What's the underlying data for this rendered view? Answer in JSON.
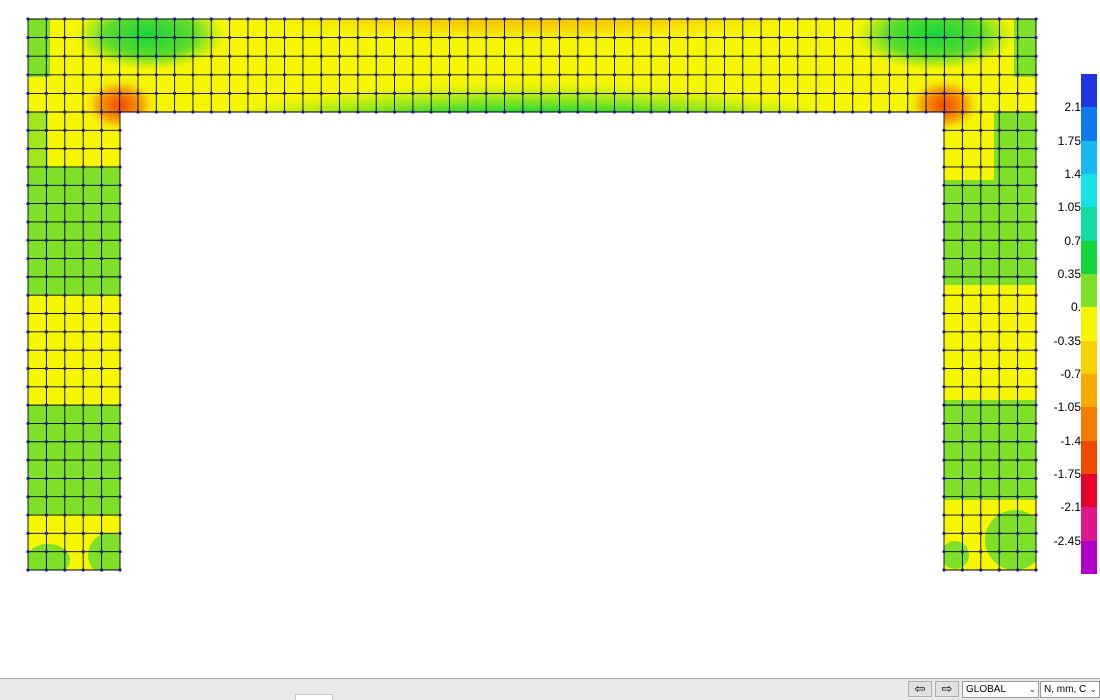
{
  "legend": {
    "labels": [
      "2.1",
      "1.75",
      "1.4",
      "1.05",
      "0.7",
      "0.35",
      "0.",
      "-0.35",
      "-0.7",
      "-1.05",
      "-1.4",
      "-1.75",
      "-2.1",
      "-2.45"
    ],
    "band_colors": [
      "#1f35e0",
      "#0f7af0",
      "#17b9f2",
      "#15e3e6",
      "#10dca4",
      "#12d63c",
      "#7fe02a",
      "#f6f600",
      "#f5d300",
      "#f6ab00",
      "#f47c00",
      "#f04a00",
      "#e8002c",
      "#e0168e",
      "#b000c8"
    ]
  },
  "statusbar": {
    "prev_icon": "arrow-left-icon",
    "next_icon": "arrow-right-icon",
    "coord_system": "GLOBAL",
    "units": "N, mm, C"
  },
  "mesh": {
    "line_color": "#000000",
    "node_color": "#1a1aa8"
  }
}
